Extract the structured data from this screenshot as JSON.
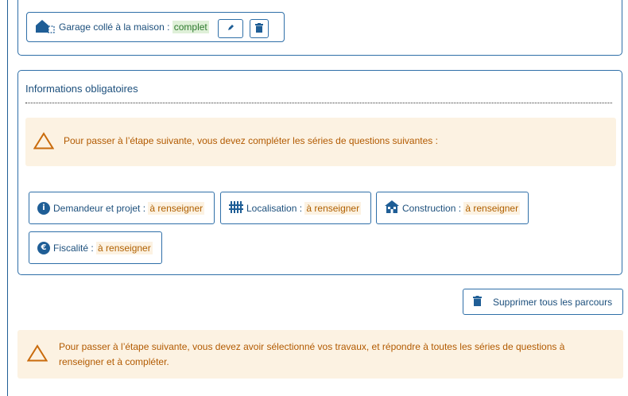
{
  "colors": {
    "primary": "#1f5e96",
    "warning_text": "#b25a00",
    "warning_bg": "#fcf2e2",
    "complete_bg": "#dff0d8",
    "complete_text": "#2f7a2f"
  },
  "garage": {
    "label": "Garage collé à la maison : ",
    "status": "complet",
    "icon": "house-garage-icon",
    "edit_icon": "pencil-icon",
    "delete_icon": "trash-icon"
  },
  "info_panel": {
    "title": "Informations obligatoires",
    "warning": "Pour passer à l’étape suivante, vous devez compléter les séries de questions suivantes :",
    "series": [
      {
        "label": "Demandeur et projet : ",
        "status": "à renseigner",
        "icon": "info-circle-icon"
      },
      {
        "label": "Localisation : ",
        "status": "à renseigner",
        "icon": "fence-icon"
      },
      {
        "label": "Construction : ",
        "status": "à renseigner",
        "icon": "house-icon"
      },
      {
        "label": "Fiscalité : ",
        "status": "à renseigner",
        "icon": "euro-circle-icon"
      }
    ]
  },
  "delete_all": {
    "label": "Supprimer tous les parcours",
    "icon": "trash-icon"
  },
  "bottom_warning": {
    "line1": "Pour passer à l’étape suivante, vous devez avoir sélectionné vos travaux, et répondre à toutes les séries de questions à",
    "line2": "renseigner et à compléter."
  }
}
